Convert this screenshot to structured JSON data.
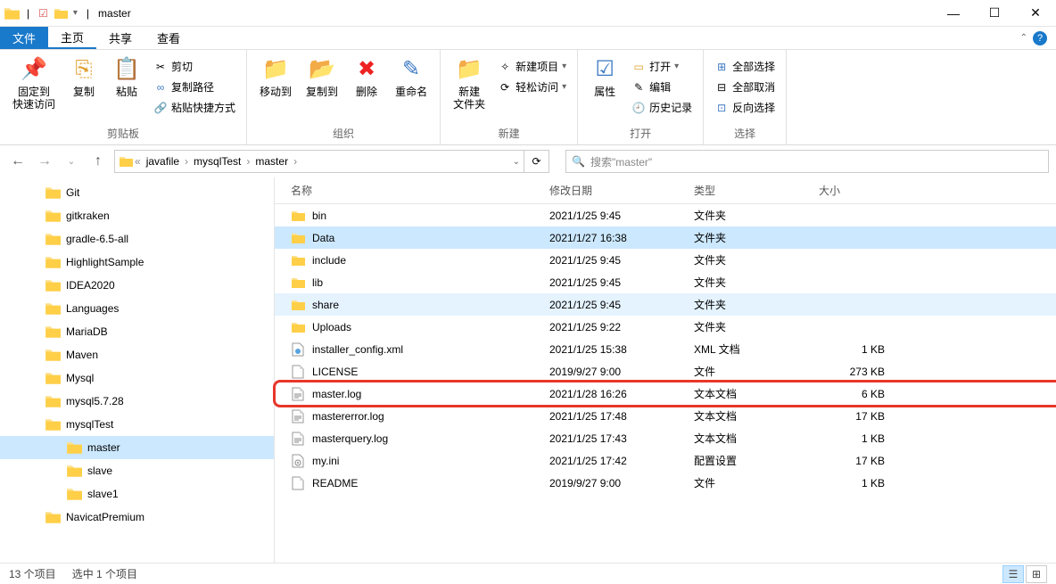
{
  "window": {
    "title": "master"
  },
  "menu": {
    "file": "文件",
    "home": "主页",
    "share": "共享",
    "view": "查看"
  },
  "ribbon": {
    "pin": "固定到\n快速访问",
    "copy": "复制",
    "paste": "粘贴",
    "cut": "剪切",
    "copypath": "复制路径",
    "pasteshortcut": "粘贴快捷方式",
    "g1": "剪贴板",
    "moveto": "移动到",
    "copyto": "复制到",
    "delete": "删除",
    "rename": "重命名",
    "g2": "组织",
    "newfolder": "新建\n文件夹",
    "newitem": "新建项目",
    "easyaccess": "轻松访问",
    "g3": "新建",
    "props": "属性",
    "open": "打开",
    "edit": "编辑",
    "history": "历史记录",
    "g4": "打开",
    "selectall": "全部选择",
    "selectnone": "全部取消",
    "invert": "反向选择",
    "g5": "选择"
  },
  "breadcrumb": {
    "p1": "javafile",
    "p2": "mysqlTest",
    "p3": "master"
  },
  "search_placeholder": "搜索\"master\"",
  "tree": [
    {
      "label": "Git"
    },
    {
      "label": "gitkraken"
    },
    {
      "label": "gradle-6.5-all"
    },
    {
      "label": "HighlightSample"
    },
    {
      "label": "IDEA2020"
    },
    {
      "label": "Languages"
    },
    {
      "label": "MariaDB"
    },
    {
      "label": "Maven"
    },
    {
      "label": "Mysql"
    },
    {
      "label": "mysql5.7.28"
    },
    {
      "label": "mysqlTest"
    },
    {
      "label": "master",
      "indent": true,
      "selected": true
    },
    {
      "label": "slave",
      "indent": true
    },
    {
      "label": "slave1",
      "indent": true
    },
    {
      "label": "NavicatPremium"
    }
  ],
  "columns": {
    "name": "名称",
    "date": "修改日期",
    "type": "类型",
    "size": "大小"
  },
  "files": [
    {
      "name": "bin",
      "date": "2021/1/25 9:45",
      "type": "文件夹",
      "size": "",
      "icon": "folder"
    },
    {
      "name": "Data",
      "date": "2021/1/27 16:38",
      "type": "文件夹",
      "size": "",
      "icon": "folder",
      "selected": true
    },
    {
      "name": "include",
      "date": "2021/1/25 9:45",
      "type": "文件夹",
      "size": "",
      "icon": "folder"
    },
    {
      "name": "lib",
      "date": "2021/1/25 9:45",
      "type": "文件夹",
      "size": "",
      "icon": "folder"
    },
    {
      "name": "share",
      "date": "2021/1/25 9:45",
      "type": "文件夹",
      "size": "",
      "icon": "folder",
      "highlighted": true
    },
    {
      "name": "Uploads",
      "date": "2021/1/25 9:22",
      "type": "文件夹",
      "size": "",
      "icon": "folder"
    },
    {
      "name": "installer_config.xml",
      "date": "2021/1/25 15:38",
      "type": "XML 文档",
      "size": "1 KB",
      "icon": "xml"
    },
    {
      "name": "LICENSE",
      "date": "2019/9/27 9:00",
      "type": "文件",
      "size": "273 KB",
      "icon": "file"
    },
    {
      "name": "master.log",
      "date": "2021/1/28 16:26",
      "type": "文本文档",
      "size": "6 KB",
      "icon": "txt",
      "boxed": true
    },
    {
      "name": "mastererror.log",
      "date": "2021/1/25 17:48",
      "type": "文本文档",
      "size": "17 KB",
      "icon": "txt"
    },
    {
      "name": "masterquery.log",
      "date": "2021/1/25 17:43",
      "type": "文本文档",
      "size": "1 KB",
      "icon": "txt"
    },
    {
      "name": "my.ini",
      "date": "2021/1/25 17:42",
      "type": "配置设置",
      "size": "17 KB",
      "icon": "ini"
    },
    {
      "name": "README",
      "date": "2019/9/27 9:00",
      "type": "文件",
      "size": "1 KB",
      "icon": "file"
    }
  ],
  "status": {
    "count": "13 个项目",
    "selected": "选中 1 个项目"
  }
}
